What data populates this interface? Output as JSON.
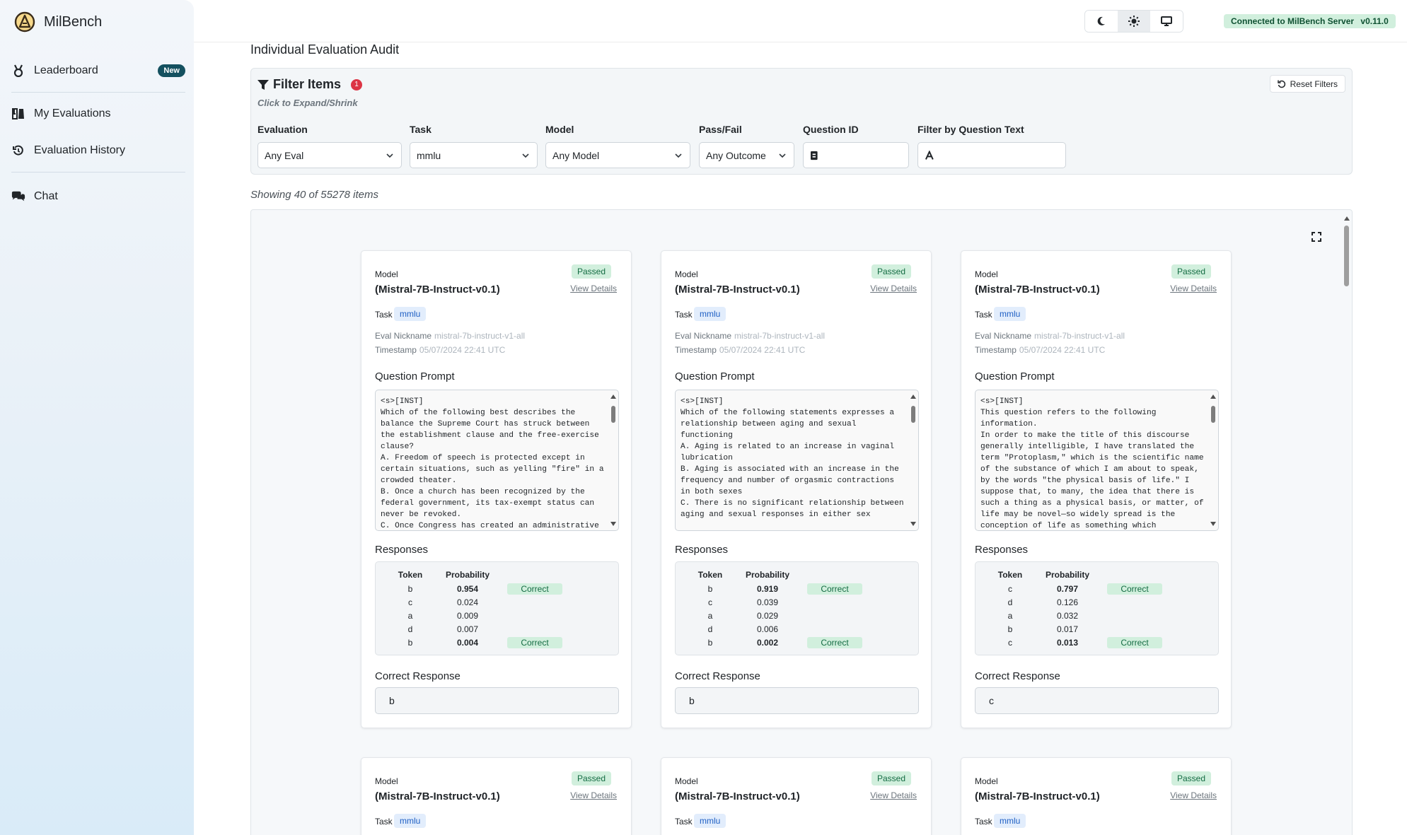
{
  "app": {
    "name": "MilBench"
  },
  "sidebar": {
    "items": [
      {
        "label": "Leaderboard",
        "badge": "New",
        "icon": "medal-icon"
      },
      {
        "label": "My Evaluations",
        "icon": "flask-icon"
      },
      {
        "label": "Evaluation History",
        "icon": "history-icon"
      },
      {
        "label": "Chat",
        "icon": "comments-icon"
      }
    ]
  },
  "topbar": {
    "theme_options": [
      "moon-icon",
      "sun-icon",
      "desktop-icon"
    ],
    "active_theme": "sun-icon",
    "server_status": "Connected to MilBench Server",
    "version": "v0.11.0"
  },
  "page": {
    "title": "Individual Evaluation Audit"
  },
  "filters": {
    "title": "Filter Items",
    "active_count": "1",
    "hint": "Click to Expand/Shrink",
    "reset_label": "Reset Filters",
    "evaluation": {
      "label": "Evaluation",
      "value": "Any Eval"
    },
    "task": {
      "label": "Task",
      "value": "mmlu"
    },
    "model": {
      "label": "Model",
      "value": "Any Model"
    },
    "pass_fail": {
      "label": "Pass/Fail",
      "value": "Any Outcome"
    },
    "question_id": {
      "label": "Question ID",
      "placeholder": ""
    },
    "question_text": {
      "label": "Filter by Question Text",
      "placeholder": ""
    }
  },
  "results": {
    "summary": "Showing 40 of 55278 items",
    "labels": {
      "model": "Model",
      "task": "Task",
      "view_details": "View Details",
      "eval_nickname": "Eval Nickname",
      "timestamp": "Timestamp",
      "question_prompt": "Question Prompt",
      "responses": "Responses",
      "token": "Token",
      "probability": "Probability",
      "correct_response": "Correct Response"
    },
    "cards": [
      {
        "status": "Passed",
        "model": "(Mistral-7B-Instruct-v0.1)",
        "task": "mmlu",
        "eval_nickname": "mistral-7b-instruct-v1-all",
        "timestamp": "05/07/2024 22:41 UTC",
        "prompt": "<s>[INST]\nWhich of the following best describes the balance the Supreme Court has struck between the establishment clause and the free-exercise clause?\nA. Freedom of speech is protected except in certain situations, such as yelling \"fire\" in a crowded theater.\nB. Once a church has been recognized by the federal government, its tax-exempt status can never be revoked.\nC. Once Congress has created an administrative",
        "responses": [
          {
            "token": "b",
            "prob": "0.954",
            "mark": "Correct"
          },
          {
            "token": "c",
            "prob": "0.024",
            "mark": ""
          },
          {
            "token": "a",
            "prob": "0.009",
            "mark": ""
          },
          {
            "token": "d",
            "prob": "0.007",
            "mark": ""
          },
          {
            "token": "b",
            "prob": "0.004",
            "mark": "Correct"
          }
        ],
        "correct": "b"
      },
      {
        "status": "Passed",
        "model": "(Mistral-7B-Instruct-v0.1)",
        "task": "mmlu",
        "eval_nickname": "mistral-7b-instruct-v1-all",
        "timestamp": "05/07/2024 22:41 UTC",
        "prompt": "<s>[INST]\nWhich of the following statements expresses a relationship between aging and sexual functioning\nA. Aging is related to an increase in vaginal lubrication\nB. Aging is associated with an increase in the frequency and number of orgasmic contractions in both sexes\nC. There is no significant relationship between aging and sexual responses in either sex",
        "responses": [
          {
            "token": "b",
            "prob": "0.919",
            "mark": "Correct"
          },
          {
            "token": "c",
            "prob": "0.039",
            "mark": ""
          },
          {
            "token": "a",
            "prob": "0.029",
            "mark": ""
          },
          {
            "token": "d",
            "prob": "0.006",
            "mark": ""
          },
          {
            "token": "b",
            "prob": "0.002",
            "mark": "Correct"
          }
        ],
        "correct": "b"
      },
      {
        "status": "Passed",
        "model": "(Mistral-7B-Instruct-v0.1)",
        "task": "mmlu",
        "eval_nickname": "mistral-7b-instruct-v1-all",
        "timestamp": "05/07/2024 22:41 UTC",
        "prompt": "<s>[INST]\nThis question refers to the following information.\nIn order to make the title of this discourse generally intelligible, I have translated the term \"Protoplasm,\" which is the scientific name of the substance of which I am about to speak, by the words \"the physical basis of life.\" I suppose that, to many, the idea that there is such a thing as a physical basis, or matter, of life may be novel—so widely spread is the conception of life as something which",
        "responses": [
          {
            "token": "c",
            "prob": "0.797",
            "mark": "Correct"
          },
          {
            "token": "d",
            "prob": "0.126",
            "mark": ""
          },
          {
            "token": "a",
            "prob": "0.032",
            "mark": ""
          },
          {
            "token": "b",
            "prob": "0.017",
            "mark": ""
          },
          {
            "token": "c",
            "prob": "0.013",
            "mark": "Correct"
          }
        ],
        "correct": "c"
      },
      {
        "status": "Passed",
        "model": "(Mistral-7B-Instruct-v0.1)",
        "task": "mmlu"
      },
      {
        "status": "Passed",
        "model": "(Mistral-7B-Instruct-v0.1)",
        "task": "mmlu"
      },
      {
        "status": "Passed",
        "model": "(Mistral-7B-Instruct-v0.1)",
        "task": "mmlu"
      }
    ]
  }
}
